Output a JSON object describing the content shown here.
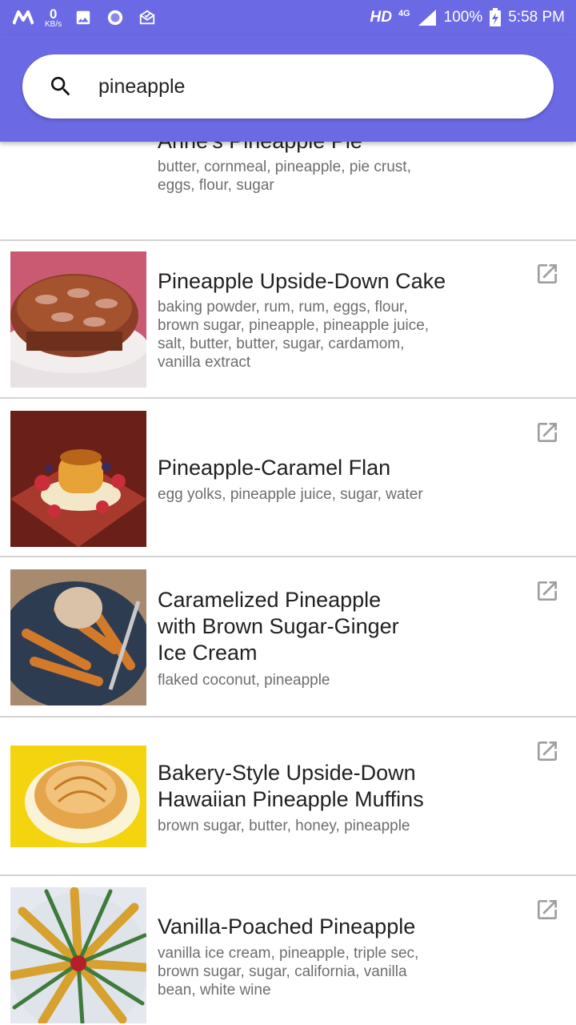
{
  "status_bar": {
    "speed_value": "0",
    "speed_unit": "KB/s",
    "hd": "HD",
    "network": "4G",
    "battery": "100%",
    "time": "5:58 PM",
    "left_icons": [
      "m-logo-icon",
      "image-icon",
      "circle-app-icon",
      "mail-check-icon"
    ]
  },
  "search": {
    "query": "pineapple",
    "icon": "search-icon"
  },
  "accent_color": "#6c69e4",
  "recipes": [
    {
      "title": "Anne's Pineapple Pie",
      "ingredients": "butter, cornmeal, pineapple, pie crust, eggs, flour, sugar"
    },
    {
      "title": "Pineapple Upside-Down Cake",
      "ingredients": "baking powder, rum, rum, eggs, flour, brown sugar, pineapple, pineapple juice, salt, butter, butter, sugar, cardamom, vanilla extract"
    },
    {
      "title": "Pineapple-Caramel Flan",
      "ingredients": "egg yolks, pineapple juice, sugar, water"
    },
    {
      "title": "Caramelized Pineapple with Brown Sugar-Ginger Ice Cream",
      "ingredients": "flaked coconut, pineapple"
    },
    {
      "title": "Bakery-Style Upside-Down Hawaiian Pineapple Muffins",
      "ingredients": "brown sugar, butter, honey, pineapple"
    },
    {
      "title": "Vanilla-Poached Pineapple",
      "ingredients": "vanilla ice cream, pineapple, triple sec, brown sugar, sugar, california, vanilla bean, white wine"
    }
  ]
}
